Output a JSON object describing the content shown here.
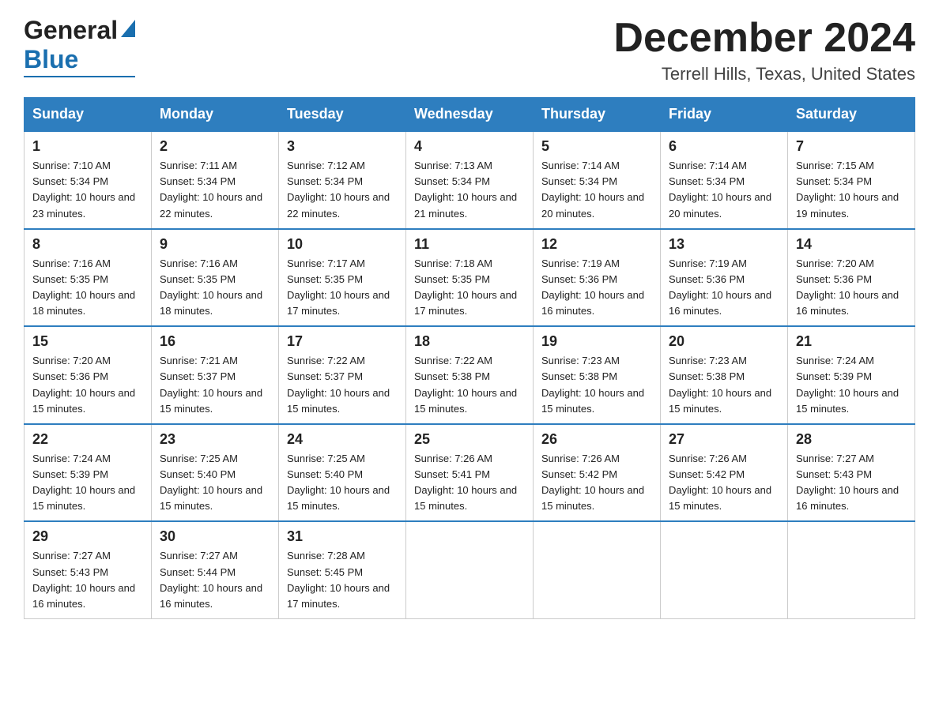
{
  "header": {
    "logo_general": "General",
    "logo_blue": "Blue",
    "month_title": "December 2024",
    "location": "Terrell Hills, Texas, United States"
  },
  "days_of_week": [
    "Sunday",
    "Monday",
    "Tuesday",
    "Wednesday",
    "Thursday",
    "Friday",
    "Saturday"
  ],
  "weeks": [
    [
      {
        "day": "1",
        "sunrise": "7:10 AM",
        "sunset": "5:34 PM",
        "daylight": "10 hours and 23 minutes."
      },
      {
        "day": "2",
        "sunrise": "7:11 AM",
        "sunset": "5:34 PM",
        "daylight": "10 hours and 22 minutes."
      },
      {
        "day": "3",
        "sunrise": "7:12 AM",
        "sunset": "5:34 PM",
        "daylight": "10 hours and 22 minutes."
      },
      {
        "day": "4",
        "sunrise": "7:13 AM",
        "sunset": "5:34 PM",
        "daylight": "10 hours and 21 minutes."
      },
      {
        "day": "5",
        "sunrise": "7:14 AM",
        "sunset": "5:34 PM",
        "daylight": "10 hours and 20 minutes."
      },
      {
        "day": "6",
        "sunrise": "7:14 AM",
        "sunset": "5:34 PM",
        "daylight": "10 hours and 20 minutes."
      },
      {
        "day": "7",
        "sunrise": "7:15 AM",
        "sunset": "5:34 PM",
        "daylight": "10 hours and 19 minutes."
      }
    ],
    [
      {
        "day": "8",
        "sunrise": "7:16 AM",
        "sunset": "5:35 PM",
        "daylight": "10 hours and 18 minutes."
      },
      {
        "day": "9",
        "sunrise": "7:16 AM",
        "sunset": "5:35 PM",
        "daylight": "10 hours and 18 minutes."
      },
      {
        "day": "10",
        "sunrise": "7:17 AM",
        "sunset": "5:35 PM",
        "daylight": "10 hours and 17 minutes."
      },
      {
        "day": "11",
        "sunrise": "7:18 AM",
        "sunset": "5:35 PM",
        "daylight": "10 hours and 17 minutes."
      },
      {
        "day": "12",
        "sunrise": "7:19 AM",
        "sunset": "5:36 PM",
        "daylight": "10 hours and 16 minutes."
      },
      {
        "day": "13",
        "sunrise": "7:19 AM",
        "sunset": "5:36 PM",
        "daylight": "10 hours and 16 minutes."
      },
      {
        "day": "14",
        "sunrise": "7:20 AM",
        "sunset": "5:36 PM",
        "daylight": "10 hours and 16 minutes."
      }
    ],
    [
      {
        "day": "15",
        "sunrise": "7:20 AM",
        "sunset": "5:36 PM",
        "daylight": "10 hours and 15 minutes."
      },
      {
        "day": "16",
        "sunrise": "7:21 AM",
        "sunset": "5:37 PM",
        "daylight": "10 hours and 15 minutes."
      },
      {
        "day": "17",
        "sunrise": "7:22 AM",
        "sunset": "5:37 PM",
        "daylight": "10 hours and 15 minutes."
      },
      {
        "day": "18",
        "sunrise": "7:22 AM",
        "sunset": "5:38 PM",
        "daylight": "10 hours and 15 minutes."
      },
      {
        "day": "19",
        "sunrise": "7:23 AM",
        "sunset": "5:38 PM",
        "daylight": "10 hours and 15 minutes."
      },
      {
        "day": "20",
        "sunrise": "7:23 AM",
        "sunset": "5:38 PM",
        "daylight": "10 hours and 15 minutes."
      },
      {
        "day": "21",
        "sunrise": "7:24 AM",
        "sunset": "5:39 PM",
        "daylight": "10 hours and 15 minutes."
      }
    ],
    [
      {
        "day": "22",
        "sunrise": "7:24 AM",
        "sunset": "5:39 PM",
        "daylight": "10 hours and 15 minutes."
      },
      {
        "day": "23",
        "sunrise": "7:25 AM",
        "sunset": "5:40 PM",
        "daylight": "10 hours and 15 minutes."
      },
      {
        "day": "24",
        "sunrise": "7:25 AM",
        "sunset": "5:40 PM",
        "daylight": "10 hours and 15 minutes."
      },
      {
        "day": "25",
        "sunrise": "7:26 AM",
        "sunset": "5:41 PM",
        "daylight": "10 hours and 15 minutes."
      },
      {
        "day": "26",
        "sunrise": "7:26 AM",
        "sunset": "5:42 PM",
        "daylight": "10 hours and 15 minutes."
      },
      {
        "day": "27",
        "sunrise": "7:26 AM",
        "sunset": "5:42 PM",
        "daylight": "10 hours and 15 minutes."
      },
      {
        "day": "28",
        "sunrise": "7:27 AM",
        "sunset": "5:43 PM",
        "daylight": "10 hours and 16 minutes."
      }
    ],
    [
      {
        "day": "29",
        "sunrise": "7:27 AM",
        "sunset": "5:43 PM",
        "daylight": "10 hours and 16 minutes."
      },
      {
        "day": "30",
        "sunrise": "7:27 AM",
        "sunset": "5:44 PM",
        "daylight": "10 hours and 16 minutes."
      },
      {
        "day": "31",
        "sunrise": "7:28 AM",
        "sunset": "5:45 PM",
        "daylight": "10 hours and 17 minutes."
      },
      null,
      null,
      null,
      null
    ]
  ]
}
